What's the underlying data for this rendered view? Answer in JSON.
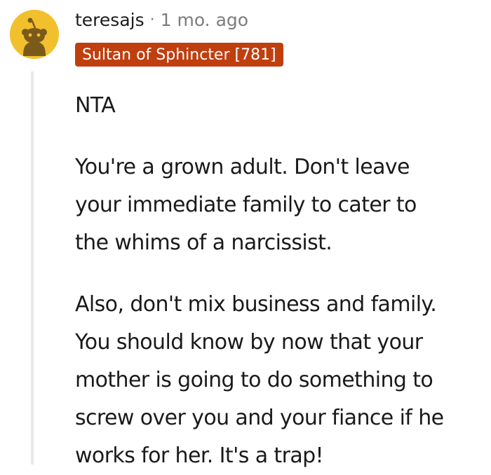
{
  "comment": {
    "username": "teresajs",
    "separator": "·",
    "timestamp": "1 mo. ago",
    "flair": "Sultan of Sphincter [781]",
    "avatar_icon": "snoo-avatar-icon",
    "colors": {
      "avatar_bg": "#f2c02c",
      "avatar_figure": "#7a5a1a",
      "flair_bg": "#bf3f0f",
      "flair_text": "#ffffff",
      "meta_text": "#7c7c7c",
      "thread_line": "#e8e8ea"
    },
    "body": {
      "p1": [
        "NTA"
      ],
      "p2": [
        "You're a grown adult. Don't leave",
        "your immediate family to cater to",
        "the whims of a narcissist."
      ],
      "p3": [
        "Also, don't mix business and family.",
        "You should know by now that your",
        "mother is going to do something to",
        "screw over you and your fiance if he",
        "works for her. It's a trap!"
      ]
    }
  }
}
